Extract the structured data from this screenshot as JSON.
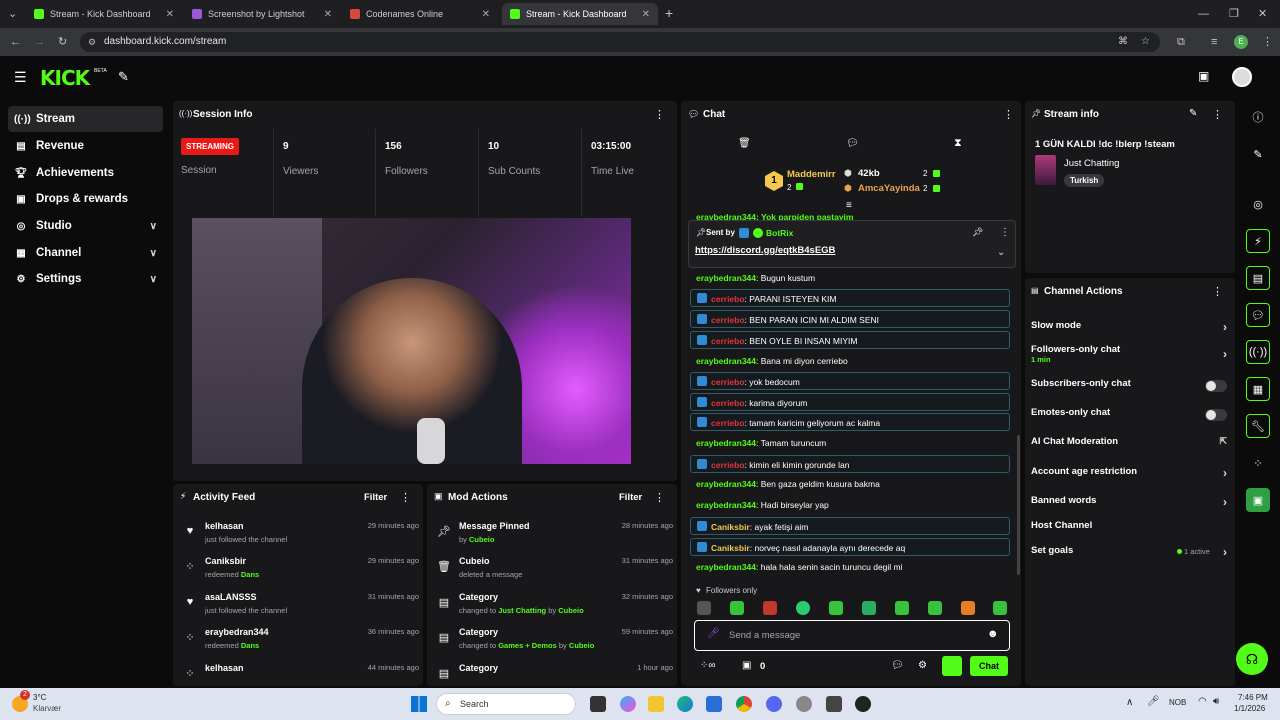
{
  "browser": {
    "tabs": [
      {
        "title": "Stream - Kick Dashboard"
      },
      {
        "title": "Screenshot by Lightshot"
      },
      {
        "title": "Codenames Online"
      },
      {
        "title": "Stream - Kick Dashboard"
      }
    ],
    "url": "dashboard.kick.com/stream",
    "profile_initial": "E"
  },
  "brand": {
    "logo": "KICK",
    "beta": "BETA",
    "accent": "#53fc18"
  },
  "sidebar": {
    "items": [
      {
        "label": "Stream",
        "icon": "stream-icon"
      },
      {
        "label": "Revenue",
        "icon": "revenue-icon"
      },
      {
        "label": "Achievements",
        "icon": "trophy-icon"
      },
      {
        "label": "Drops & rewards",
        "icon": "gift-icon"
      },
      {
        "label": "Studio",
        "icon": "studio-icon"
      },
      {
        "label": "Channel",
        "icon": "channel-icon"
      },
      {
        "label": "Settings",
        "icon": "gear-icon"
      }
    ]
  },
  "session": {
    "title": "Session Info",
    "status_badge": "STREAMING",
    "status_label": "Session",
    "stats": [
      {
        "value": "9",
        "label": "Viewers"
      },
      {
        "value": "156",
        "label": "Followers"
      },
      {
        "value": "10",
        "label": "Sub Counts"
      },
      {
        "value": "03:15:00",
        "label": "Time Live"
      }
    ]
  },
  "activity": {
    "title": "Activity Feed",
    "filter": "Filter",
    "items": [
      {
        "name": "kelhasan",
        "detail": "just followed the channel",
        "highlight": "",
        "time": "29 minutes ago",
        "icon": "heart-icon"
      },
      {
        "name": "Caniksbir",
        "detail": "redeemed",
        "highlight": "Dans",
        "time": "29 minutes ago",
        "icon": "points-icon"
      },
      {
        "name": "asaLANSSS",
        "detail": "just followed the channel",
        "highlight": "",
        "time": "31 minutes ago",
        "icon": "heart-icon"
      },
      {
        "name": "eraybedran344",
        "detail": "redeemed",
        "highlight": "Dans",
        "time": "36 minutes ago",
        "icon": "points-icon"
      },
      {
        "name": "kelhasan",
        "detail": "",
        "highlight": "",
        "time": "44 minutes ago",
        "icon": "points-icon"
      }
    ]
  },
  "mod": {
    "title": "Mod Actions",
    "filter": "Filter",
    "items": [
      {
        "name": "Message Pinned",
        "pre": "by",
        "hl1": "Cubeio",
        "mid": "",
        "hl2": "",
        "time": "28 minutes ago",
        "icon": "pin-icon"
      },
      {
        "name": "Cubeio",
        "pre": "deleted a message",
        "hl1": "",
        "mid": "",
        "hl2": "",
        "time": "31 minutes ago",
        "icon": "trash-icon"
      },
      {
        "name": "Category",
        "pre": "changed to",
        "hl1": "Just Chatting",
        "mid": "by",
        "hl2": "Cubeio",
        "time": "32 minutes ago",
        "icon": "category-icon"
      },
      {
        "name": "Category",
        "pre": "changed to",
        "hl1": "Games + Demos",
        "mid": "by",
        "hl2": "Cubeio",
        "time": "59 minutes ago",
        "icon": "category-icon"
      },
      {
        "name": "Category",
        "pre": "",
        "hl1": "",
        "mid": "",
        "hl2": "",
        "time": "1 hour ago",
        "icon": "category-icon"
      }
    ]
  },
  "chat": {
    "title": "Chat",
    "leaderboard": {
      "rank": "1",
      "top_user": "Maddemirr",
      "top_count": "2",
      "kb": "42kb",
      "kb_count": "2",
      "second_user": "AmcaYayinda",
      "second_count": "2"
    },
    "pinned": {
      "sent_by_label": "Sent by",
      "sender": "BotRix",
      "link": "https://discord.gg/eqtkB4sEGB",
      "behind_text": "eraybedran344: Yok parpiden pastayim"
    },
    "messages": [
      {
        "user": "eraybedran344",
        "text": "Bugun kustum",
        "style": "green",
        "boxed": false
      },
      {
        "user": "cerriebo",
        "text": "PARANI ISTEYEN KIM",
        "style": "red",
        "boxed": true
      },
      {
        "user": "cerriebo",
        "text": "BEN PARAN ICIN MI ALDIM SENI",
        "style": "red",
        "boxed": true
      },
      {
        "user": "cerriebo",
        "text": "BEN OYLE BI INSAN MIYIM",
        "style": "red",
        "boxed": true
      },
      {
        "user": "eraybedran344",
        "text": "Bana mi diyon cerriebo",
        "style": "green",
        "boxed": false
      },
      {
        "user": "cerriebo",
        "text": "yok bedocum",
        "style": "red",
        "boxed": true
      },
      {
        "user": "cerriebo",
        "text": "karima diyorum",
        "style": "red",
        "boxed": true
      },
      {
        "user": "cerriebo",
        "text": "tamam karicim geliyorum ac kalma",
        "style": "red",
        "boxed": true
      },
      {
        "user": "eraybedran344",
        "text": "Tamam turuncum",
        "style": "green",
        "boxed": false
      },
      {
        "user": "cerriebo",
        "text": "kimin eli kimin gorunde lan",
        "style": "red",
        "boxed": true
      },
      {
        "user": "eraybedran344",
        "text": "Ben gaza geldim kusura bakma",
        "style": "green",
        "boxed": false
      },
      {
        "user": "eraybedran344",
        "text": "Hadi birseylar yap",
        "style": "green",
        "boxed": false
      },
      {
        "user": "Caniksbir",
        "text": "ayak fetişi aim",
        "style": "gold",
        "boxed": true
      },
      {
        "user": "Caniksbir",
        "text": "norveç nasıl adanayla aynı derecede aq",
        "style": "gold",
        "boxed": true
      },
      {
        "user": "eraybedran344",
        "text": "hala hala senin sacin turuncu degil mi",
        "style": "green",
        "boxed": false
      }
    ],
    "followers_only": "Followers only",
    "input_placeholder": "Send a message",
    "points": "0",
    "send_button": "Chat"
  },
  "stream_info": {
    "title": "Stream info",
    "stream_title": "1 GÜN KALDI !dc !blerp !steam",
    "category": "Just Chatting",
    "tag": "Turkish"
  },
  "channel_actions": {
    "title": "Channel Actions",
    "slow_mode": "Slow mode",
    "followers_only": "Followers-only chat",
    "followers_only_value": "1 min",
    "subscribers_only": "Subscribers-only chat",
    "emotes_only": "Emotes-only chat",
    "ai_moderation": "AI Chat Moderation",
    "account_age": "Account age restriction",
    "banned_words": "Banned words",
    "host_channel": "Host Channel",
    "set_goals": "Set goals",
    "goals_status": "1 active"
  },
  "taskbar": {
    "weather_temp": "3°C",
    "weather_desc": "Klarvær",
    "weather_badge": "2",
    "search": "Search",
    "lang": "NOB",
    "time": "7:46 PM",
    "date": "1/1/2026"
  }
}
